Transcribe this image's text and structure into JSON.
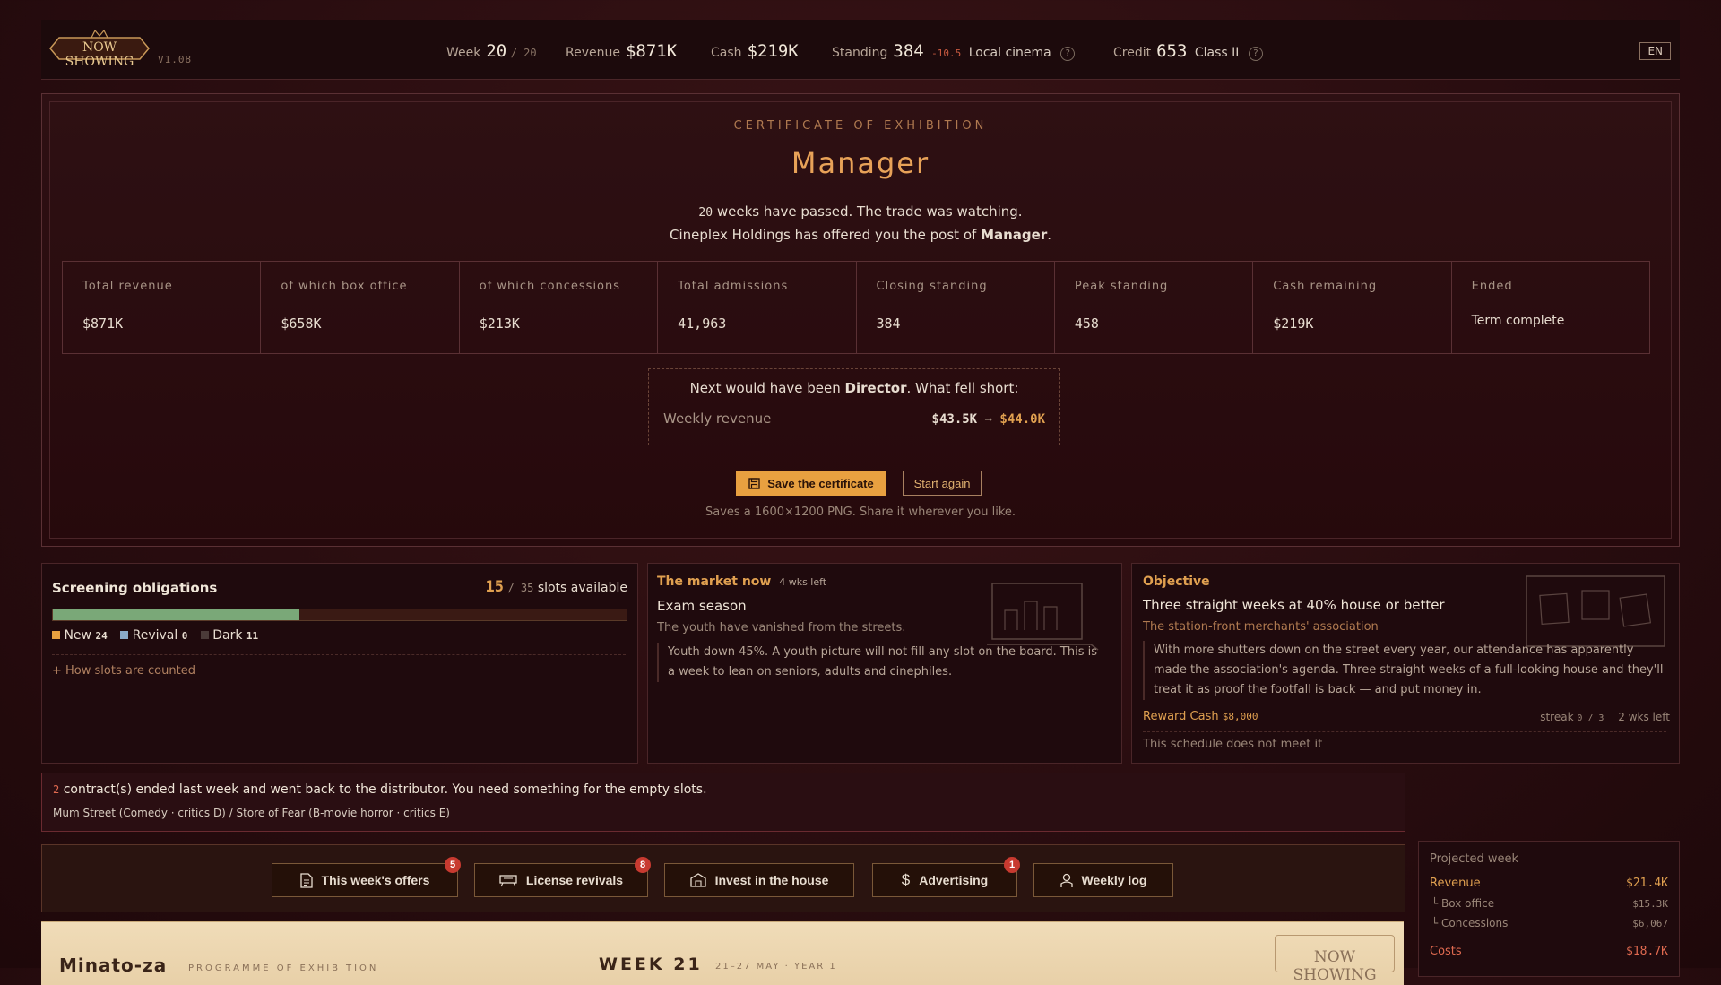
{
  "app": {
    "logo": "NOW SHOWING",
    "version": "V1.08",
    "lang": "EN"
  },
  "topbar": {
    "week_label": "Week",
    "week": "20",
    "week_total": "/ 20",
    "revenue_label": "Revenue",
    "revenue": "$871K",
    "cash_label": "Cash",
    "cash": "$219K",
    "standing_label": "Standing",
    "standing": "384",
    "standing_delta": "-10.5",
    "standing_tier": "Local cinema",
    "credit_label": "Credit",
    "credit": "653",
    "credit_class": "Class II"
  },
  "certificate": {
    "kicker": "CERTIFICATE OF EXHIBITION",
    "title": "Manager",
    "weeks": "20",
    "line1_rest": "weeks have passed. The trade was watching.",
    "line2_pre": "Cineplex Holdings has offered you the post of",
    "line2_post": "Manager",
    "stats": [
      {
        "label": "Total revenue",
        "value": "$871K"
      },
      {
        "label": "of which box office",
        "value": "$658K"
      },
      {
        "label": "of which concessions",
        "value": "$213K"
      },
      {
        "label": "Total admissions",
        "value": "41,963"
      },
      {
        "label": "Closing standing",
        "value": "384"
      },
      {
        "label": "Peak standing",
        "value": "458"
      },
      {
        "label": "Cash remaining",
        "value": "$219K"
      },
      {
        "label": "Ended",
        "value": "Term complete"
      }
    ],
    "next_pre": "Next would have been",
    "next_rank": "Director",
    "next_post": ". What fell short:",
    "short_label": "Weekly revenue",
    "short_from": "$43.5K",
    "short_arrow": "→",
    "short_to": "$44.0K",
    "save_label": "Save the certificate",
    "again_label": "Start again",
    "note": "Saves a 1600×1200 PNG. Share it wherever you like."
  },
  "obligations": {
    "title": "Screening obligations",
    "slots": "15",
    "slots_total": "/ 35",
    "slots_label": "slots available",
    "progress": 0.43,
    "new_label": "New",
    "new_count": "24",
    "revival_label": "Revival",
    "revival_count": "0",
    "dark_label": "Dark",
    "dark_count": "11",
    "how_link": "+ How slots are counted"
  },
  "market": {
    "title": "The market now",
    "weeks_left": "4 wks left",
    "event": "Exam season",
    "subtitle": "The youth have vanished from the streets.",
    "body": "Youth down 45%. A youth picture will not fill any slot on the board. This is a week to lean on seniors, adults and cinephiles."
  },
  "objective": {
    "title": "Objective",
    "goal": "Three straight weeks at 40% house or better",
    "sponsor": "The station-front merchants' association",
    "body": "With more shutters down on the street every year, our attendance has apparently made the association's agenda. Three straight weeks of a full-looking house and they'll treat it as proof the footfall is back — and put money in.",
    "reward_label": "Reward Cash",
    "reward_value": "$8,000",
    "streak_label": "streak",
    "streak_value": "0 / 3",
    "weeks_left": "2 wks left",
    "status": "This schedule does not meet it"
  },
  "notice": {
    "count": "2",
    "text": "contract(s) ended last week and went back to the distributor. You need something for the empty slots.",
    "films": "Mum Street (Comedy · critics D) / Store of Fear (B-movie horror · critics E)"
  },
  "actions": [
    {
      "label": "This week's offers",
      "badge": "5"
    },
    {
      "label": "License revivals",
      "badge": "8"
    },
    {
      "label": "Invest in the house",
      "badge": ""
    },
    {
      "label": "Advertising",
      "badge": "1"
    },
    {
      "label": "Weekly log",
      "badge": ""
    }
  ],
  "projected": {
    "title": "Projected week",
    "revenue_label": "Revenue",
    "revenue": "$21.4K",
    "box_label": "└ Box office",
    "box": "$15.3K",
    "conc_label": "└ Concessions",
    "conc": "$6,067",
    "costs_label": "Costs",
    "costs": "$18.7K"
  },
  "programme": {
    "theatre": "Minato-za",
    "kicker": "PROGRAMME OF EXHIBITION",
    "week": "WEEK 21",
    "dates": "21–27 MAY · YEAR 1",
    "logo": "NOW SHOWING"
  },
  "colors": {
    "accent": "#e0a050",
    "new": "#e8a040",
    "revival": "#8aaac8",
    "dark": "#4a3a38",
    "progress": "#7aa878",
    "badge": "#c83a30"
  }
}
